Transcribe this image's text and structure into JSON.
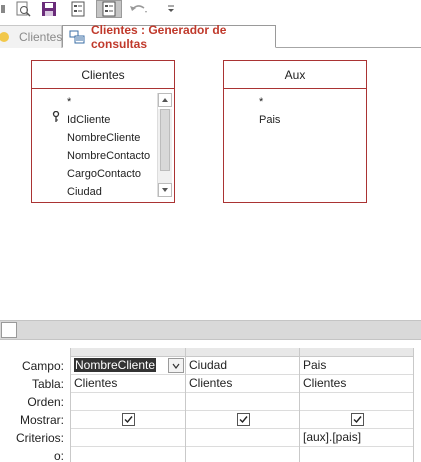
{
  "tabs": {
    "inactive_label": "Clientes",
    "active_label": "Clientes : Generador de consultas"
  },
  "tables": [
    {
      "title": "Clientes",
      "fields": [
        "*",
        "IdCliente",
        "NombreCliente",
        "NombreContacto",
        "CargoContacto",
        "Ciudad"
      ]
    },
    {
      "title": "Aux",
      "fields": [
        "*",
        "Pais"
      ]
    }
  ],
  "grid": {
    "row_labels": [
      "Campo:",
      "Tabla:",
      "Orden:",
      "Mostrar:",
      "Criterios:",
      "o:"
    ],
    "columns": [
      {
        "campo": "NombreCliente",
        "tabla": "Clientes",
        "orden": "",
        "mostrar": true,
        "criterios": ""
      },
      {
        "campo": "Ciudad",
        "tabla": "Clientes",
        "orden": "",
        "mostrar": true,
        "criterios": ""
      },
      {
        "campo": "Pais",
        "tabla": "Clientes",
        "orden": "",
        "mostrar": true,
        "criterios": "[aux].[pais]"
      }
    ]
  },
  "colors": {
    "accent": "#c0392b",
    "table_border": "#aa3333"
  }
}
